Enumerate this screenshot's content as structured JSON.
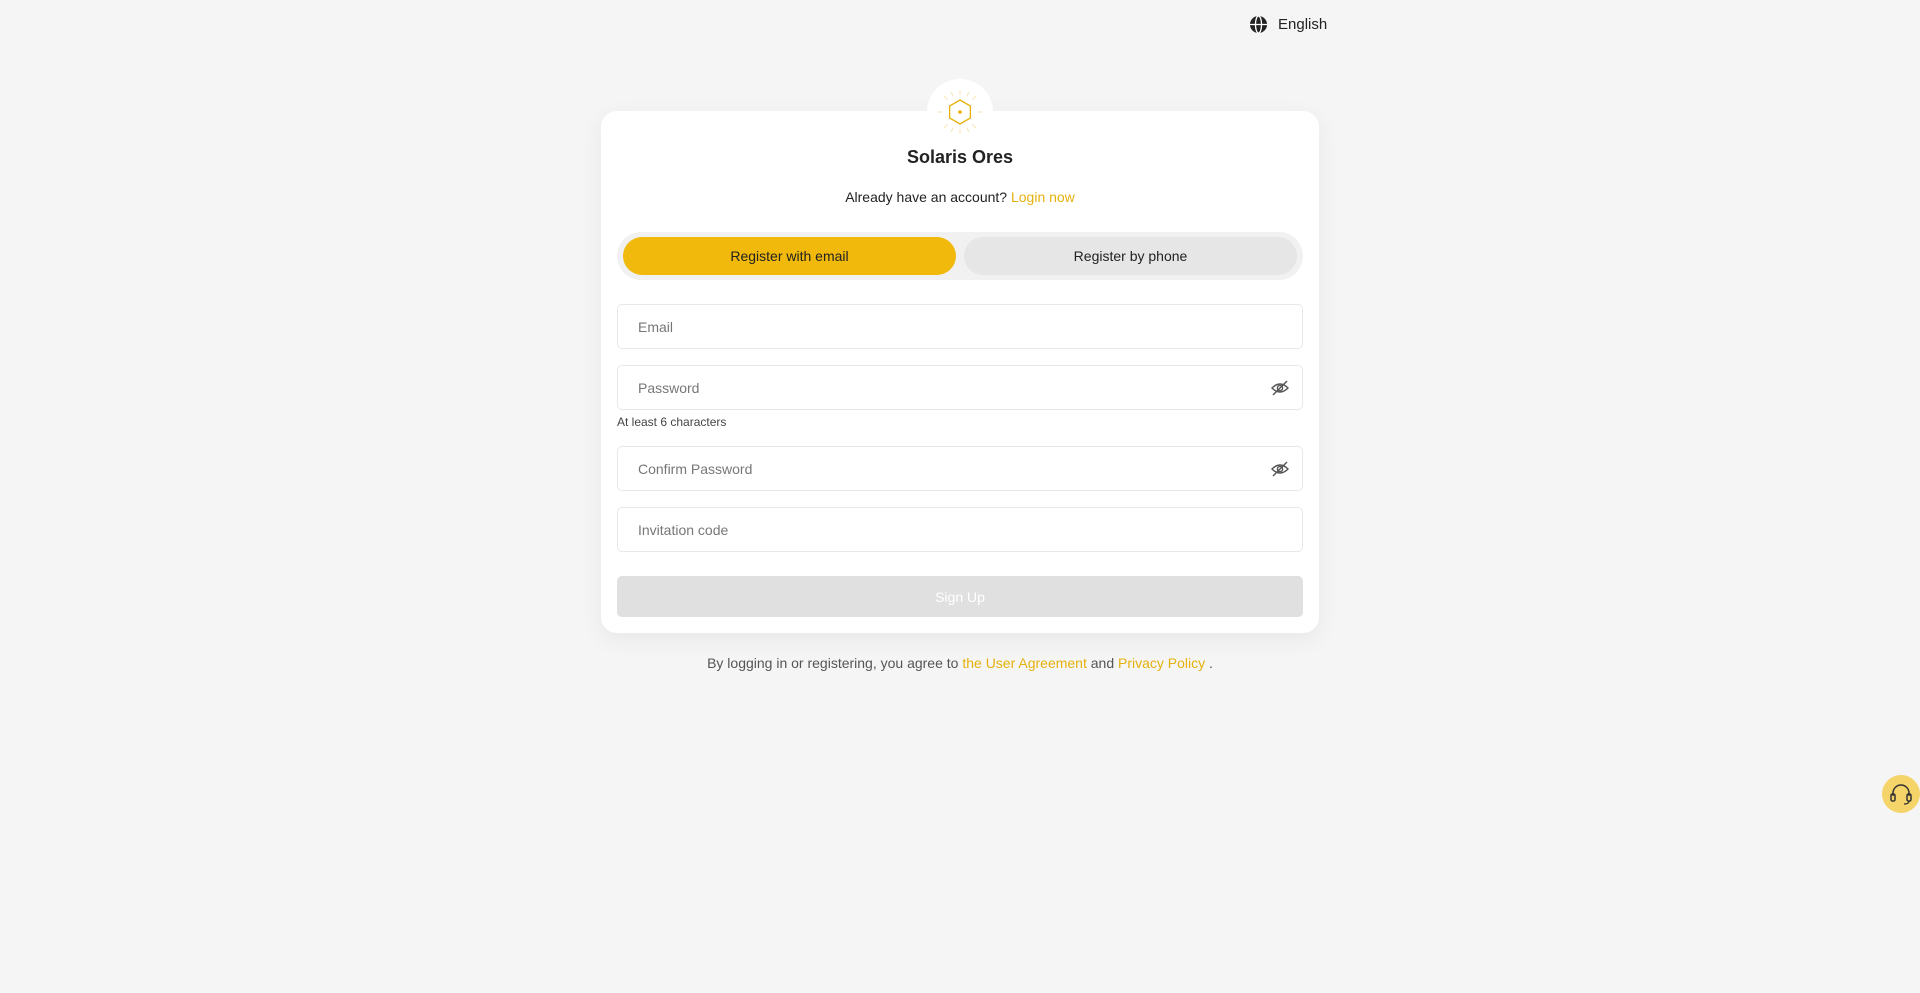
{
  "header": {
    "language_label": "English",
    "language_icon": "globe-icon"
  },
  "brand": {
    "logo_icon": "hexagon-sun-logo",
    "title": "Solaris Ores"
  },
  "login_prompt": {
    "text": "Already have an account?",
    "link": "Login now"
  },
  "tabs": [
    {
      "label": "Register with email",
      "active": true
    },
    {
      "label": "Register by phone",
      "active": false
    }
  ],
  "form": {
    "email_placeholder": "Email",
    "password_placeholder": "Password",
    "password_hint": "At least 6 characters",
    "confirm_placeholder": "Confirm Password",
    "invitation_placeholder": "Invitation code",
    "eye_icon": "eye-off-icon",
    "submit_label": "Sign Up"
  },
  "agreement": {
    "prefix": "By logging in or registering, you agree to",
    "user_agreement": "the User Agreement",
    "and": "and",
    "privacy_policy": "Privacy Policy",
    "suffix": "."
  },
  "support": {
    "icon": "headset-icon"
  },
  "colors": {
    "accent": "#f0b90b",
    "link": "#e6b10b",
    "background": "#f5f5f5",
    "disabled_button": "#e0e0e0"
  }
}
